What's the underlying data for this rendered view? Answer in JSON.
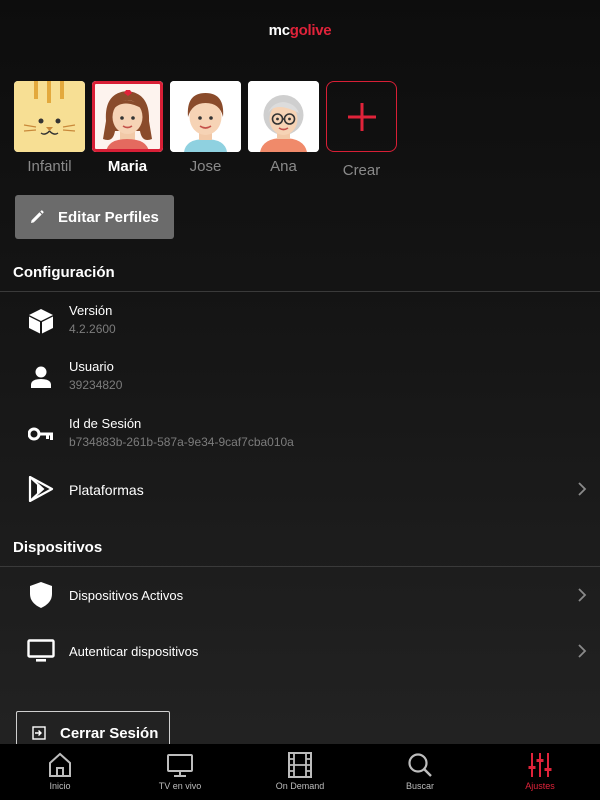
{
  "app": {
    "logo_mc": "mc",
    "logo_golive": "golive"
  },
  "profiles": [
    {
      "name": "Infantil",
      "avatar": "cat-avatar"
    },
    {
      "name": "Maria",
      "avatar": "girl-avatar",
      "selected": true
    },
    {
      "name": "Jose",
      "avatar": "boy-avatar"
    },
    {
      "name": "Ana",
      "avatar": "grandma-avatar"
    }
  ],
  "create_label": "Crear",
  "edit_profiles_label": "Editar Perfiles",
  "config": {
    "title": "Configuración",
    "version_label": "Versión",
    "version_value": "4.2.2600",
    "user_label": "Usuario",
    "user_value": "39234820",
    "session_label": "Id de Sesión",
    "session_value": "b734883b-261b-587a-9e34-9caf7cba010a",
    "platforms_label": "Plataformas"
  },
  "devices": {
    "title": "Dispositivos",
    "active_label": "Dispositivos Activos",
    "auth_label": "Autenticar dispositivos"
  },
  "logout_label": "Cerrar Sesión",
  "tabs": [
    {
      "label": "Inicio",
      "icon": "home-icon"
    },
    {
      "label": "TV en vivo",
      "icon": "tv-icon"
    },
    {
      "label": "On Demand",
      "icon": "film-icon"
    },
    {
      "label": "Buscar",
      "icon": "search-icon"
    },
    {
      "label": "Ajustes",
      "icon": "sliders-icon",
      "active": true
    }
  ],
  "colors": {
    "accent": "#e0233a",
    "background": "#111111",
    "button": "#6b6b6b"
  }
}
